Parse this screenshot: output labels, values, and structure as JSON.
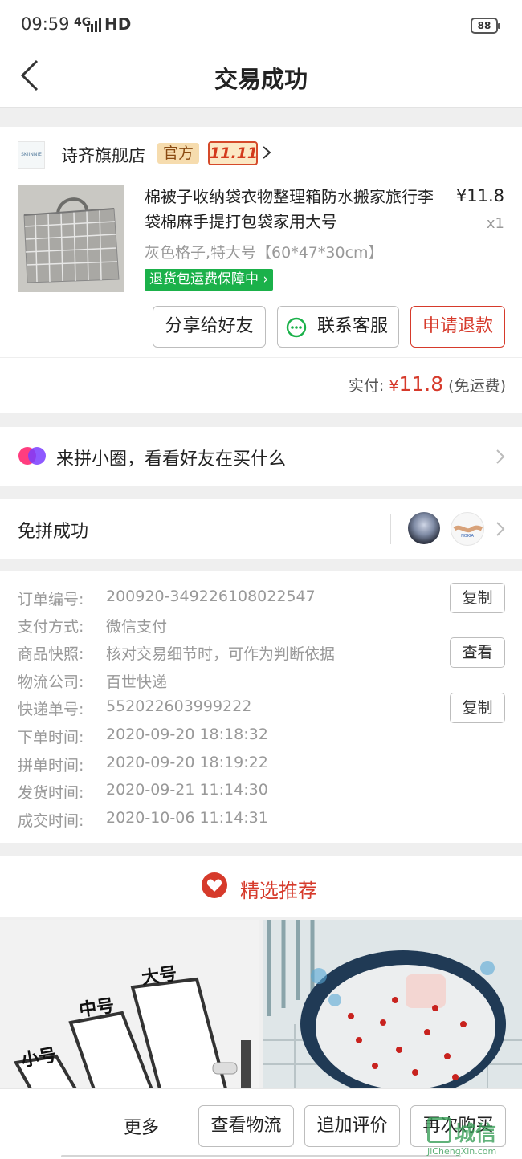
{
  "status_bar": {
    "time": "09:59",
    "network": "4G",
    "signal_label": "HD",
    "battery": "88"
  },
  "nav": {
    "title": "交易成功"
  },
  "order": {
    "shop_logo_text": "SKIINNIE 诗齐",
    "shop_name": "诗齐旗舰店",
    "official_tag": "官方",
    "promo_tag": "11.11",
    "product_title": "棉被子收纳袋衣物整理箱防水搬家旅行李袋棉麻手提打包袋家用大号",
    "price": "¥11.8",
    "quantity": "x1",
    "spec": "灰色格子,特大号【60*47*30cm】",
    "guarantee": "退货包运费保障中",
    "buttons": {
      "share": "分享给好友",
      "contact": "联系客服",
      "refund": "申请退款"
    },
    "paid_label": "实付:",
    "paid_currency": "¥",
    "paid_amount": "11.8",
    "paid_note": "(免运费)"
  },
  "circle": {
    "label": "来拼小圈，看看好友在买什么"
  },
  "group": {
    "label": "免拼成功",
    "avatar2_text": "NOKIA"
  },
  "details": [
    {
      "label": "订单编号:",
      "value": "200920-349226108022547",
      "action": "复制"
    },
    {
      "label": "支付方式:",
      "value": "微信支付"
    },
    {
      "label": "商品快照:",
      "value": "核对交易细节时，可作为判断依据",
      "action": "查看"
    },
    {
      "label": "物流公司:",
      "value": "百世快递"
    },
    {
      "label": "快递单号:",
      "value": "552022603999222",
      "action": "复制"
    },
    {
      "label": "下单时间:",
      "value": "2020-09-20 18:18:32"
    },
    {
      "label": "拼单时间:",
      "value": "2020-09-20 18:19:22"
    },
    {
      "label": "发货时间:",
      "value": "2020-09-21 11:14:30"
    },
    {
      "label": "成交时间:",
      "value": "2020-10-06 11:14:31"
    }
  ],
  "recommend": {
    "title": "精选推荐",
    "item1_labels": {
      "large": "大号",
      "medium": "中号",
      "small": "小号"
    }
  },
  "bottom_bar": {
    "more": "更多",
    "logistics": "查看物流",
    "review": "追加评价",
    "rebuy": "再次购买"
  },
  "watermark": {
    "text": "城信",
    "sub": "JiChengXin.com"
  },
  "colors": {
    "accent_red": "#d63a2b",
    "green": "#1bb14a",
    "official_bg": "#f6dcae"
  }
}
